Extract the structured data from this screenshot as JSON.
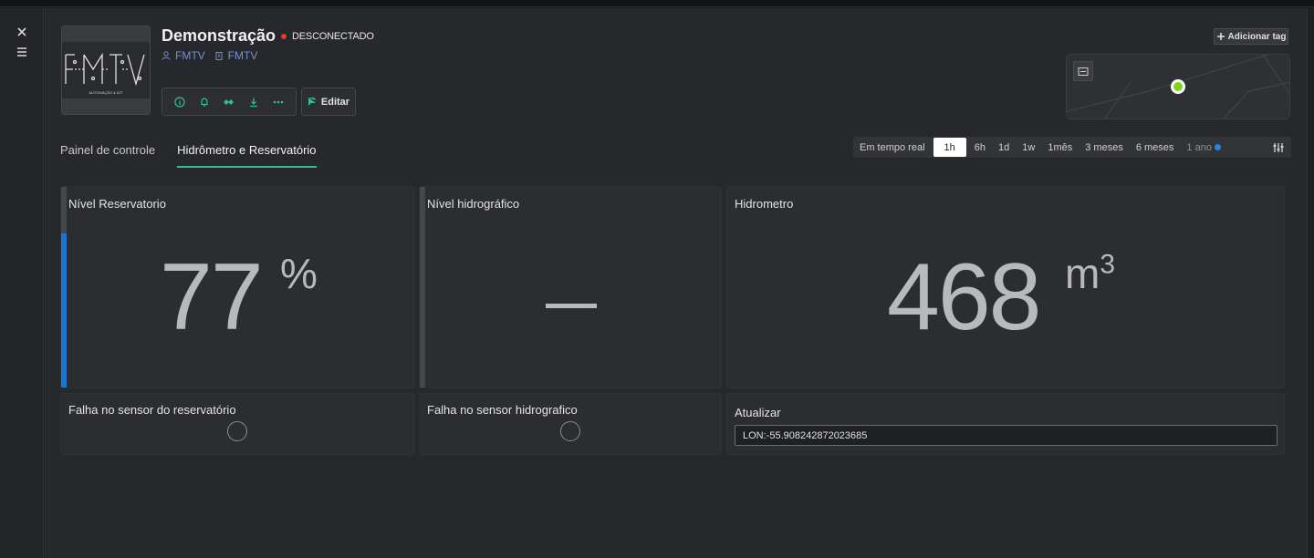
{
  "header": {
    "title": "Demonstração",
    "status": "DESCONECTADO",
    "status_color": "#e53935",
    "owner_user": "FMTV",
    "owner_org": "FMTV",
    "logo_text": "FMTV",
    "edit_label": "Editar",
    "add_tag_label": "Adicionar tag"
  },
  "tabs": [
    {
      "label": "Painel de controle",
      "active": false
    },
    {
      "label": "Hidrômetro e Reservatório",
      "active": true
    }
  ],
  "range": {
    "options": [
      "Em tempo real",
      "1h",
      "6h",
      "1d",
      "1w",
      "1mês",
      "3 meses",
      "6 meses",
      "1 ano"
    ],
    "selected": "1h"
  },
  "widgets": {
    "reservoir": {
      "title": "Nível Reservatorio",
      "value": "77",
      "unit": "%",
      "level_fraction": 0.77
    },
    "hydro": {
      "title": "Nível hidrográfico",
      "value": "–"
    },
    "meter": {
      "title": "Hidrometro",
      "value": "468",
      "unit": "m",
      "unit_exp": "3"
    },
    "fail_reservoir": {
      "title": "Falha no sensor do reservatório"
    },
    "fail_hydro": {
      "title": "Falha no sensor hidrografico"
    },
    "update": {
      "title": "Atualizar",
      "value": "LON:-55.908242872023685"
    }
  },
  "colors": {
    "accent": "#2fbf8f",
    "gauge": "#1976d2",
    "map_marker": "#7ed321",
    "owner_link": "#6f93d8"
  }
}
